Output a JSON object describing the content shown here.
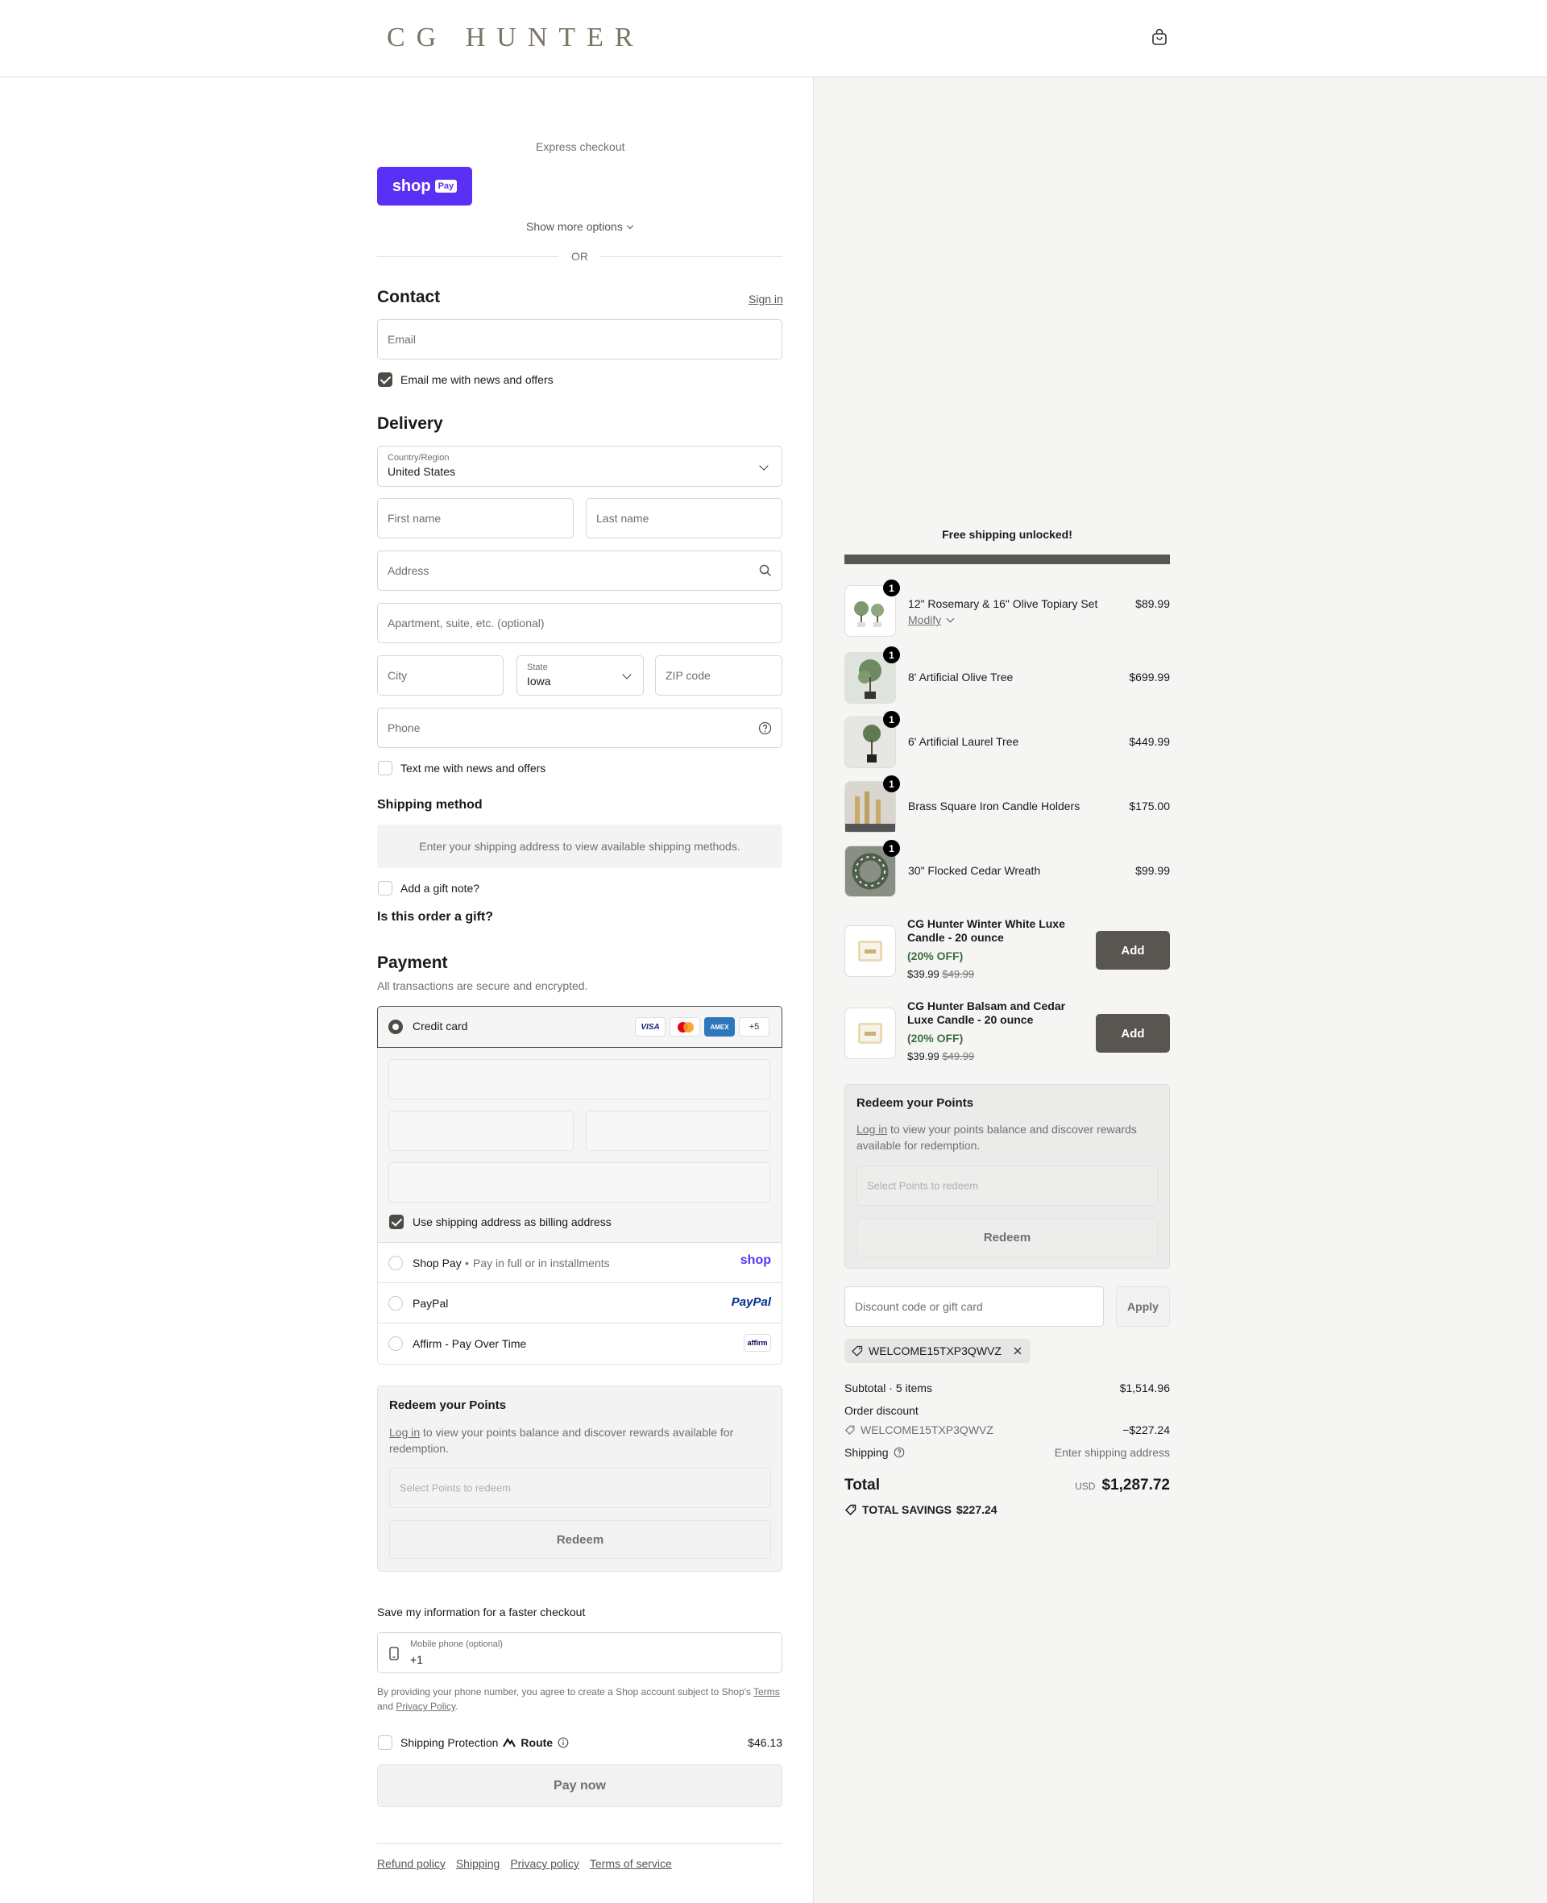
{
  "header": {
    "logo": "CG HUNTER"
  },
  "express": {
    "title": "Express checkout",
    "shop_pay_text": "shop",
    "shop_pay_badge": "Pay",
    "more_options": "Show more options",
    "or": "OR"
  },
  "contact": {
    "title": "Contact",
    "sign_in": "Sign in",
    "email_placeholder": "Email",
    "news_label": "Email me with news and offers",
    "news_checked": true
  },
  "delivery": {
    "title": "Delivery",
    "country_label": "Country/Region",
    "country_value": "United States",
    "first_name": "First name",
    "last_name": "Last name",
    "address": "Address",
    "apartment": "Apartment, suite, etc. (optional)",
    "city": "City",
    "state_label": "State",
    "state_value": "Iowa",
    "zip": "ZIP code",
    "phone": "Phone",
    "text_label": "Text me with news and offers"
  },
  "shipping_method": {
    "title": "Shipping method",
    "message": "Enter your shipping address to view available shipping methods."
  },
  "gift": {
    "note_label": "Add a gift note?",
    "gift_question": "Is this order a gift?"
  },
  "payment": {
    "title": "Payment",
    "subtitle": "All transactions are secure and encrypted.",
    "credit_card": "Credit card",
    "card_more": "+5",
    "billing_label": "Use shipping address as billing address",
    "shop_pay": "Shop Pay",
    "shop_pay_sub": "Pay in full or in installments",
    "shop_logo": "shop",
    "paypal": "PayPal",
    "paypal_logo": "PayPal",
    "affirm": "Affirm - Pay Over Time",
    "affirm_logo": "affirm"
  },
  "redeem_left": {
    "title": "Redeem your Points",
    "login": "Log in",
    "text": " to view your points balance and discover rewards available for redemption.",
    "select": "Select Points to redeem",
    "button": "Redeem"
  },
  "save_info": {
    "title": "Save my information for a faster checkout",
    "phone_label": "Mobile phone (optional)",
    "phone_value": "+1",
    "legal_prefix": "By providing your phone number, you agree to create a Shop account subject to Shop's ",
    "terms": "Terms",
    "and": "and ",
    "privacy": "Privacy Policy",
    "dot": "."
  },
  "protection": {
    "label": "Shipping Protection",
    "brand": "Route",
    "price": "$46.13"
  },
  "pay_now": "Pay now",
  "footer": {
    "links": [
      "Refund policy",
      "Shipping",
      "Privacy policy",
      "Terms of service"
    ]
  },
  "summary": {
    "free_shipping": "Free shipping unlocked!",
    "progress_fraction": 1.0,
    "items": [
      {
        "qty": "1",
        "name": "12\" Rosemary & 16\" Olive Topiary Set",
        "modify": "Modify",
        "price": "$89.99"
      },
      {
        "qty": "1",
        "name": "8' Artificial Olive Tree",
        "price": "$699.99"
      },
      {
        "qty": "1",
        "name": "6' Artificial Laurel Tree",
        "price": "$449.99"
      },
      {
        "qty": "1",
        "name": "Brass Square Iron Candle Holders",
        "price": "$175.00"
      },
      {
        "qty": "1",
        "name": "30\" Flocked Cedar Wreath",
        "price": "$99.99"
      }
    ],
    "upsells": [
      {
        "name": "CG Hunter Winter White Luxe Candle - 20 ounce",
        "off": "(20% OFF)",
        "price": "$39.99",
        "compare": "$49.99",
        "button": "Add"
      },
      {
        "name": "CG Hunter Balsam and Cedar Luxe Candle - 20 ounce",
        "off": "(20% OFF)",
        "price": "$39.99",
        "compare": "$49.99",
        "button": "Add"
      }
    ],
    "redeem": {
      "title": "Redeem your Points",
      "login": "Log in",
      "text": " to view your points balance and discover rewards available for redemption.",
      "select": "Select Points to redeem",
      "button": "Redeem"
    },
    "discount_placeholder": "Discount code or gift card",
    "apply": "Apply",
    "code": "WELCOME15TXP3QWVZ",
    "subtotal_label": "Subtotal · 5 items",
    "subtotal": "$1,514.96",
    "order_discount": "Order discount",
    "discount_code": "WELCOME15TXP3QWVZ",
    "discount_amount": "−$227.24",
    "shipping_label": "Shipping",
    "shipping_value": "Enter shipping address",
    "total_label": "Total",
    "currency": "USD",
    "total": "$1,287.72",
    "savings_label": "TOTAL SAVINGS",
    "savings": "$227.24"
  },
  "colors": {
    "accent": "#4f4b45",
    "shop_pay": "#5a31f4",
    "upsell_green": "#3b6e3b",
    "paypal_blue": "#003087"
  }
}
